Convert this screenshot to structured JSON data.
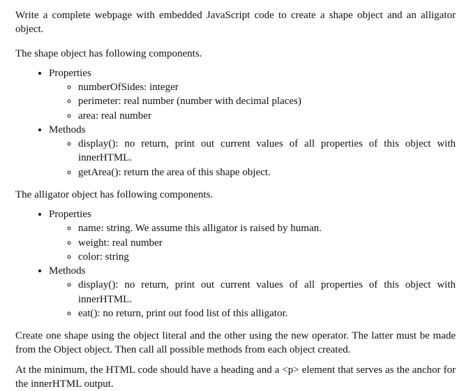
{
  "intro": "Write a complete webpage with embedded JavaScript code to create a shape object and an alligator object.",
  "shape": {
    "lead": "The shape object has following components.",
    "propLabel": "Properties",
    "props": [
      "numberOfSides: integer",
      "perimeter: real number (number with decimal places)",
      "area: real number"
    ],
    "methodLabel": "Methods",
    "methods": [
      "display(): no return, print out current values of all properties of this object with innerHTML.",
      "getArea(): return the area of this shape object."
    ]
  },
  "alligator": {
    "lead": "The alligator object has following components.",
    "propLabel": "Properties",
    "props": [
      "name: string. We assume this alligator is raised by human.",
      "weight: real number",
      "color: string"
    ],
    "methodLabel": "Methods",
    "methods": [
      "display(): no return, print out current values of all properties of this object with innerHTML.",
      "eat(): no return, print out food list of this alligator."
    ]
  },
  "createPara": "Create one shape using the object literal and the other using the new operator. The latter must be made from the Object object. Then call all possible methods from each object created.",
  "minPara": "At the minimum, the HTML code should have a heading and a <p> element that serves as the anchor for the innerHTML output."
}
